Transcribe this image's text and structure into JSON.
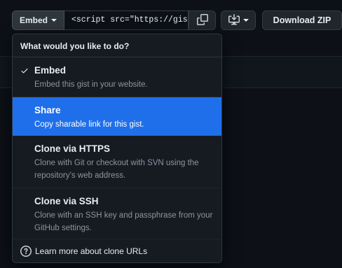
{
  "toolbar": {
    "embed_label": "Embed",
    "url_value": "<script src=\"https://gist.github.com/",
    "download_label": "Download ZIP",
    "icons": {
      "caret": "triangle-down-icon",
      "copy": "copy-icon",
      "desktop": "desktop-download-icon"
    }
  },
  "dropdown": {
    "header": "What would you like to do?",
    "items": [
      {
        "title": "Embed",
        "desc": "Embed this gist in your website.",
        "checked": true
      },
      {
        "title": "Share",
        "desc": "Copy sharable link for this gist.",
        "highlighted": true
      },
      {
        "title": "Clone via HTTPS",
        "desc": "Clone with Git or checkout with SVN using the repository’s web address."
      },
      {
        "title": "Clone via SSH",
        "desc": "Clone with an SSH key and passphrase from your GitHub settings."
      }
    ],
    "footer_link": "Learn more about clone URLs"
  },
  "colors": {
    "background": "#0d1117",
    "menu_bg": "#161b22",
    "highlight": "#1f6feb",
    "muted_text": "#8b949e",
    "border": "#30363d"
  }
}
